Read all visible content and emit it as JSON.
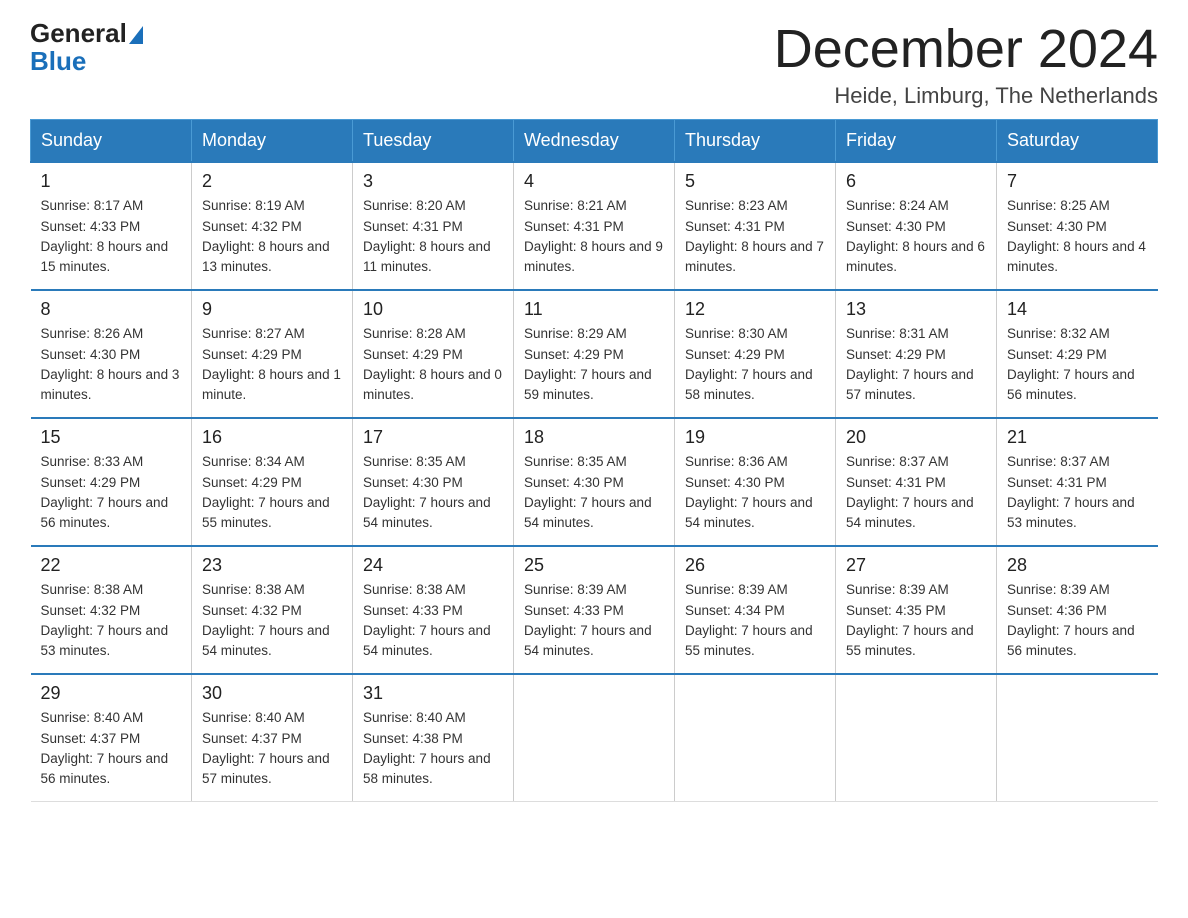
{
  "logo": {
    "general": "General",
    "blue": "Blue"
  },
  "title": "December 2024",
  "location": "Heide, Limburg, The Netherlands",
  "weekdays": [
    "Sunday",
    "Monday",
    "Tuesday",
    "Wednesday",
    "Thursday",
    "Friday",
    "Saturday"
  ],
  "weeks": [
    [
      {
        "day": "1",
        "sunrise": "8:17 AM",
        "sunset": "4:33 PM",
        "daylight": "8 hours and 15 minutes."
      },
      {
        "day": "2",
        "sunrise": "8:19 AM",
        "sunset": "4:32 PM",
        "daylight": "8 hours and 13 minutes."
      },
      {
        "day": "3",
        "sunrise": "8:20 AM",
        "sunset": "4:31 PM",
        "daylight": "8 hours and 11 minutes."
      },
      {
        "day": "4",
        "sunrise": "8:21 AM",
        "sunset": "4:31 PM",
        "daylight": "8 hours and 9 minutes."
      },
      {
        "day": "5",
        "sunrise": "8:23 AM",
        "sunset": "4:31 PM",
        "daylight": "8 hours and 7 minutes."
      },
      {
        "day": "6",
        "sunrise": "8:24 AM",
        "sunset": "4:30 PM",
        "daylight": "8 hours and 6 minutes."
      },
      {
        "day": "7",
        "sunrise": "8:25 AM",
        "sunset": "4:30 PM",
        "daylight": "8 hours and 4 minutes."
      }
    ],
    [
      {
        "day": "8",
        "sunrise": "8:26 AM",
        "sunset": "4:30 PM",
        "daylight": "8 hours and 3 minutes."
      },
      {
        "day": "9",
        "sunrise": "8:27 AM",
        "sunset": "4:29 PM",
        "daylight": "8 hours and 1 minute."
      },
      {
        "day": "10",
        "sunrise": "8:28 AM",
        "sunset": "4:29 PM",
        "daylight": "8 hours and 0 minutes."
      },
      {
        "day": "11",
        "sunrise": "8:29 AM",
        "sunset": "4:29 PM",
        "daylight": "7 hours and 59 minutes."
      },
      {
        "day": "12",
        "sunrise": "8:30 AM",
        "sunset": "4:29 PM",
        "daylight": "7 hours and 58 minutes."
      },
      {
        "day": "13",
        "sunrise": "8:31 AM",
        "sunset": "4:29 PM",
        "daylight": "7 hours and 57 minutes."
      },
      {
        "day": "14",
        "sunrise": "8:32 AM",
        "sunset": "4:29 PM",
        "daylight": "7 hours and 56 minutes."
      }
    ],
    [
      {
        "day": "15",
        "sunrise": "8:33 AM",
        "sunset": "4:29 PM",
        "daylight": "7 hours and 56 minutes."
      },
      {
        "day": "16",
        "sunrise": "8:34 AM",
        "sunset": "4:29 PM",
        "daylight": "7 hours and 55 minutes."
      },
      {
        "day": "17",
        "sunrise": "8:35 AM",
        "sunset": "4:30 PM",
        "daylight": "7 hours and 54 minutes."
      },
      {
        "day": "18",
        "sunrise": "8:35 AM",
        "sunset": "4:30 PM",
        "daylight": "7 hours and 54 minutes."
      },
      {
        "day": "19",
        "sunrise": "8:36 AM",
        "sunset": "4:30 PM",
        "daylight": "7 hours and 54 minutes."
      },
      {
        "day": "20",
        "sunrise": "8:37 AM",
        "sunset": "4:31 PM",
        "daylight": "7 hours and 54 minutes."
      },
      {
        "day": "21",
        "sunrise": "8:37 AM",
        "sunset": "4:31 PM",
        "daylight": "7 hours and 53 minutes."
      }
    ],
    [
      {
        "day": "22",
        "sunrise": "8:38 AM",
        "sunset": "4:32 PM",
        "daylight": "7 hours and 53 minutes."
      },
      {
        "day": "23",
        "sunrise": "8:38 AM",
        "sunset": "4:32 PM",
        "daylight": "7 hours and 54 minutes."
      },
      {
        "day": "24",
        "sunrise": "8:38 AM",
        "sunset": "4:33 PM",
        "daylight": "7 hours and 54 minutes."
      },
      {
        "day": "25",
        "sunrise": "8:39 AM",
        "sunset": "4:33 PM",
        "daylight": "7 hours and 54 minutes."
      },
      {
        "day": "26",
        "sunrise": "8:39 AM",
        "sunset": "4:34 PM",
        "daylight": "7 hours and 55 minutes."
      },
      {
        "day": "27",
        "sunrise": "8:39 AM",
        "sunset": "4:35 PM",
        "daylight": "7 hours and 55 minutes."
      },
      {
        "day": "28",
        "sunrise": "8:39 AM",
        "sunset": "4:36 PM",
        "daylight": "7 hours and 56 minutes."
      }
    ],
    [
      {
        "day": "29",
        "sunrise": "8:40 AM",
        "sunset": "4:37 PM",
        "daylight": "7 hours and 56 minutes."
      },
      {
        "day": "30",
        "sunrise": "8:40 AM",
        "sunset": "4:37 PM",
        "daylight": "7 hours and 57 minutes."
      },
      {
        "day": "31",
        "sunrise": "8:40 AM",
        "sunset": "4:38 PM",
        "daylight": "7 hours and 58 minutes."
      },
      null,
      null,
      null,
      null
    ]
  ]
}
